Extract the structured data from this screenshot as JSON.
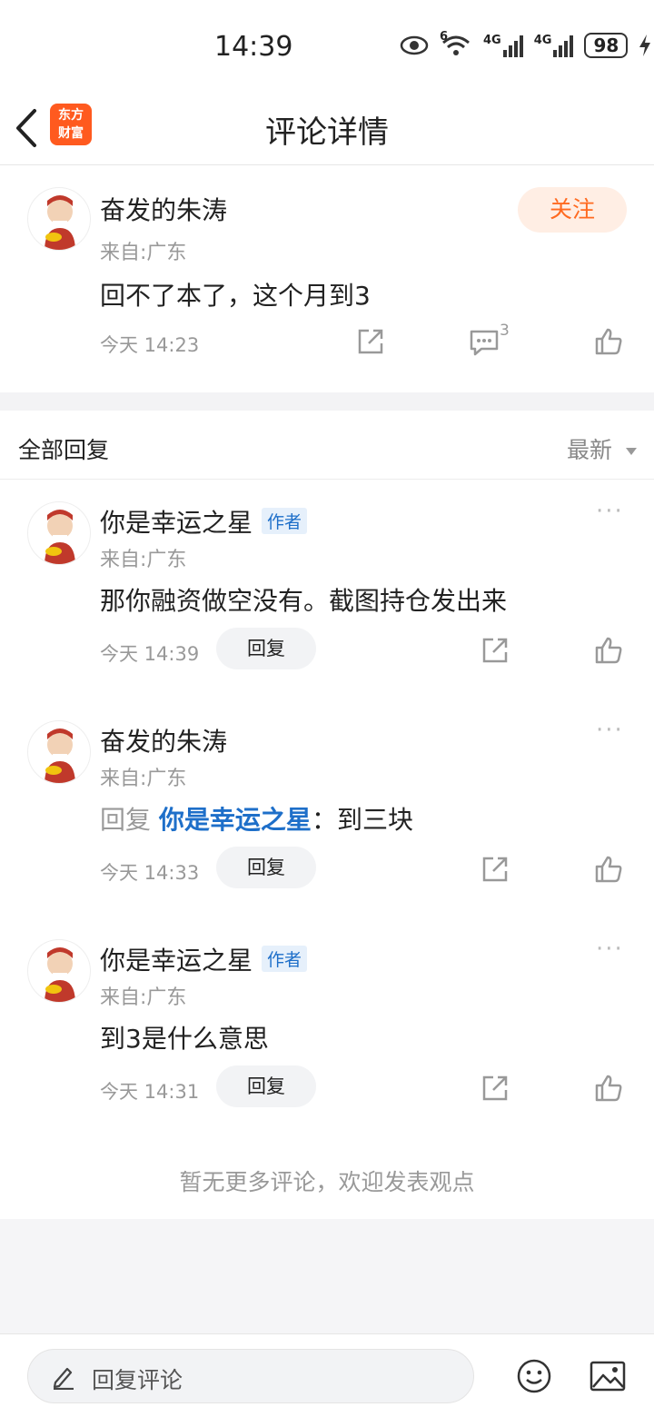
{
  "status": {
    "time": "14:39",
    "battery": "98",
    "net1": "4G",
    "net2": "4G",
    "wifi_badge": "6"
  },
  "header": {
    "title": "评论详情",
    "logo_line1": "东方",
    "logo_line2": "财富"
  },
  "main_comment": {
    "username": "奋发的朱涛",
    "location": "来自:广东",
    "content": "回不了本了，这个月到3",
    "time": "今天 14:23",
    "reply_count": "3",
    "follow_label": "关注"
  },
  "replies_header": {
    "title": "全部回复",
    "sort": "最新"
  },
  "replies": [
    {
      "username": "你是幸运之星",
      "tag": "作者",
      "location": "来自:广东",
      "content": "那你融资做空没有。截图持仓发出来",
      "time": "今天 14:39",
      "reply_label": "回复"
    },
    {
      "username": "奋发的朱涛",
      "location": "来自:广东",
      "reply_prefix": "回复",
      "reply_to": "你是幸运之星",
      "content": "：到三块",
      "time": "今天 14:33",
      "reply_label": "回复"
    },
    {
      "username": "你是幸运之星",
      "tag": "作者",
      "location": "来自:广东",
      "content": "到3是什么意思",
      "time": "今天 14:31",
      "reply_label": "回复"
    }
  ],
  "no_more": "暂无更多评论，欢迎发表观点",
  "bottom": {
    "placeholder": "回复评论"
  },
  "colors": {
    "accent": "#ff6a20",
    "link": "#1e6fc9"
  }
}
